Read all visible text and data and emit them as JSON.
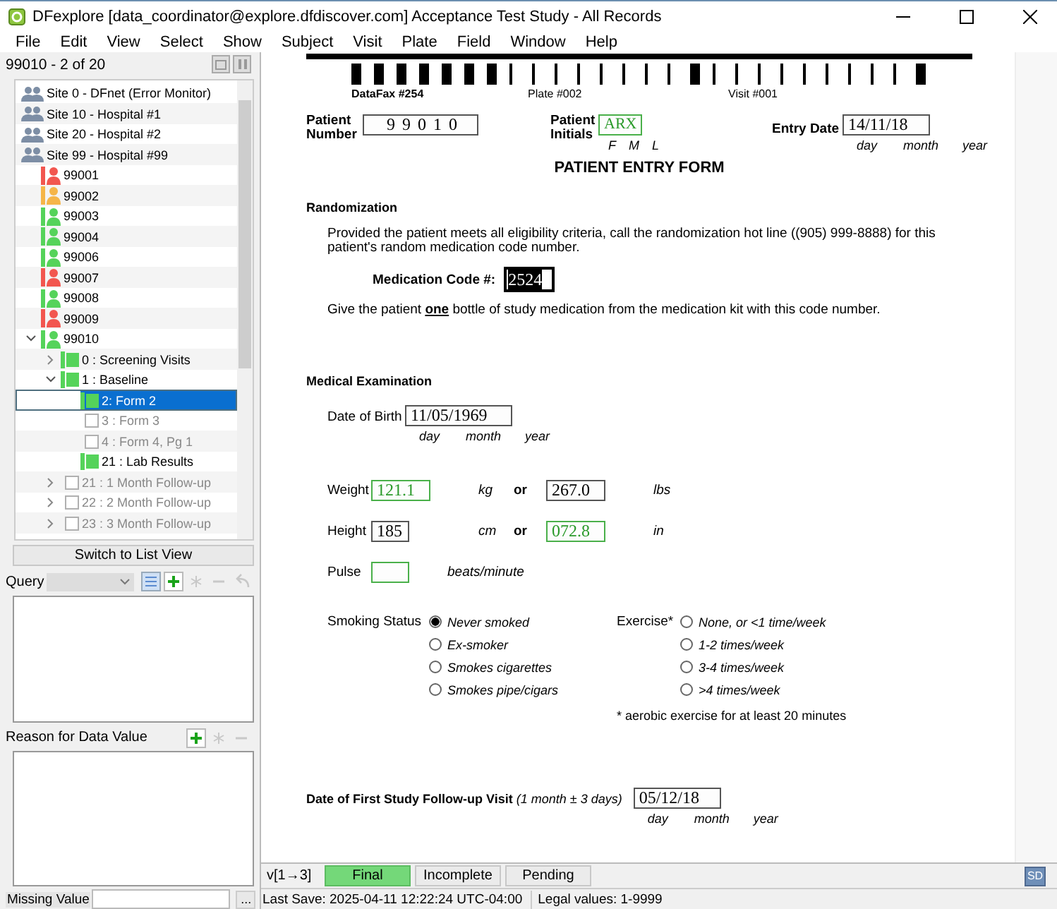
{
  "window": {
    "title": "DFexplore [data_coordinator@explore.dfdiscover.com] Acceptance Test Study - All Records"
  },
  "menu": [
    "File",
    "Edit",
    "View",
    "Select",
    "Show",
    "Subject",
    "Visit",
    "Plate",
    "Field",
    "Window",
    "Help"
  ],
  "navigator": {
    "position": "99010 - 2 of 20",
    "switch_button": "Switch to List View",
    "tree": [
      {
        "kind": "site",
        "label": "Site 0 - DFnet (Error Monitor)",
        "selected": false
      },
      {
        "kind": "site",
        "label": "Site 10 - Hospital #1",
        "selected": false
      },
      {
        "kind": "site",
        "label": "Site 20 - Hospital #2",
        "selected": false
      },
      {
        "kind": "site",
        "label": "Site 99 - Hospital #99",
        "selected": false
      },
      {
        "kind": "patient",
        "label": "99001",
        "color": "#f2564f",
        "selected": false
      },
      {
        "kind": "patient",
        "label": "99002",
        "color": "#f5b548",
        "selected": false
      },
      {
        "kind": "patient",
        "label": "99003",
        "color": "#55d35a",
        "selected": false
      },
      {
        "kind": "patient",
        "label": "99004",
        "color": "#55d35a",
        "selected": false
      },
      {
        "kind": "patient",
        "label": "99006",
        "color": "#55d35a",
        "selected": false
      },
      {
        "kind": "patient",
        "label": "99007",
        "color": "#f2564f",
        "selected": false
      },
      {
        "kind": "patient",
        "label": "99008",
        "color": "#55d35a",
        "selected": false
      },
      {
        "kind": "patient",
        "label": "99009",
        "color": "#f2564f",
        "selected": false
      },
      {
        "kind": "patient",
        "label": "99010",
        "color": "#55d35a",
        "expanded": true,
        "selected": false,
        "children": [
          {
            "kind": "visit",
            "label": "0 : Screening Visits",
            "color": "#55d35a",
            "expanded": false,
            "selected": false
          },
          {
            "kind": "visit",
            "label": "1 : Baseline",
            "color": "#55d35a",
            "expanded": true,
            "selected": false,
            "children": [
              {
                "kind": "plate",
                "label": "2: Form 2",
                "color": "#55d35a",
                "selected": true
              },
              {
                "kind": "plate",
                "label": "3 : Form 3",
                "selected": false
              },
              {
                "kind": "plate",
                "label": "4 : Form 4, Pg 1",
                "selected": false
              },
              {
                "kind": "plate",
                "label": "21 : Lab Results",
                "color": "#55d35a",
                "selected": false
              }
            ]
          },
          {
            "kind": "visit",
            "label": "21 : 1 Month Follow-up",
            "expanded": false,
            "selected": false
          },
          {
            "kind": "visit",
            "label": "22 : 2 Month Follow-up",
            "expanded": false,
            "selected": false
          },
          {
            "kind": "visit",
            "label": "23 : 3 Month Follow-up",
            "expanded": false,
            "selected": false
          }
        ]
      }
    ]
  },
  "query": {
    "label": "Query"
  },
  "reason": {
    "label": "Reason for Data Value"
  },
  "missing_value": {
    "label": "Missing Value",
    "button": "..."
  },
  "form": {
    "header": {
      "datafax": "DataFax #254",
      "plate": "Plate #002",
      "visit": "Visit #001"
    },
    "patient_number": {
      "label": "Patient Number",
      "value": "9 9 0 1 0",
      "highlight": false
    },
    "patient_initials": {
      "label": "Patient Initials",
      "value": "ARX",
      "highlight": true,
      "sublabels": [
        "F",
        "M",
        "L"
      ]
    },
    "entry_date": {
      "label": "Entry Date",
      "value": "14/11/18",
      "highlight": false,
      "sublabels": [
        "day",
        "month",
        "year"
      ]
    },
    "title": "PATIENT ENTRY FORM",
    "randomization": {
      "heading": "Randomization",
      "text": "Provided the patient meets all eligibility criteria, call the randomization hot line ((905) 999-8888) for this patient's random medication code number.",
      "code_label": "Medication Code #:",
      "code": {
        "value": "2524",
        "focused": true
      },
      "instruction": "Give the patient **one** bottle of study medication from the medication kit with this code number."
    },
    "exam": {
      "heading": "Medical Examination",
      "dob": {
        "label": "Date of Birth",
        "value": "11/05/1969",
        "highlight": false,
        "sublabels": [
          "day",
          "month",
          "year"
        ]
      },
      "measurements": [
        {
          "label": "Weight",
          "metric": {
            "value": "121.1",
            "highlight": true
          },
          "metric_unit": "kg",
          "or": "or",
          "imperial": {
            "value": "267.0",
            "highlight": false
          },
          "imperial_unit": "lbs"
        },
        {
          "label": "Height",
          "metric": {
            "value": "185",
            "highlight": false
          },
          "metric_unit": "cm",
          "or": "or",
          "imperial": {
            "value": "072.8",
            "highlight": true
          },
          "imperial_unit": "in"
        }
      ],
      "pulse": {
        "label": "Pulse",
        "highlight": true,
        "unit": "beats/minute"
      },
      "smoking": {
        "label": "Smoking Status",
        "options": [
          {
            "label": "Never smoked",
            "selected": true
          },
          {
            "label": "Ex-smoker",
            "selected": false
          },
          {
            "label": "Smokes cigarettes",
            "selected": false
          },
          {
            "label": "Smokes pipe/cigars",
            "selected": false
          }
        ]
      },
      "exercise": {
        "label": "Exercise*",
        "options": [
          {
            "label": "None, or <1 time/week",
            "selected": false
          },
          {
            "label": "1-2 times/week",
            "selected": false
          },
          {
            "label": "3-4 times/week",
            "selected": false
          },
          {
            "label": ">4 times/week",
            "selected": false
          }
        ],
        "footnote": "* aerobic exercise for at least 20 minutes"
      }
    },
    "followup": {
      "label": "**Date of First Study Follow-up Visit** *(1 month ± 3 days)*",
      "value": "05/12/18",
      "highlight": false,
      "sublabels": [
        "day",
        "month",
        "year"
      ]
    }
  },
  "version": "v[1→3]",
  "status_buttons": [
    {
      "label": "Final",
      "selected": true
    },
    {
      "label": "Incomplete",
      "selected": false
    },
    {
      "label": "Pending",
      "selected": false
    }
  ],
  "sd_button": "SD",
  "status_bar": {
    "last_save": "Last Save: 2025-04-11 12:22:24 UTC-04:00",
    "legal": "Legal values: 1-9999"
  }
}
